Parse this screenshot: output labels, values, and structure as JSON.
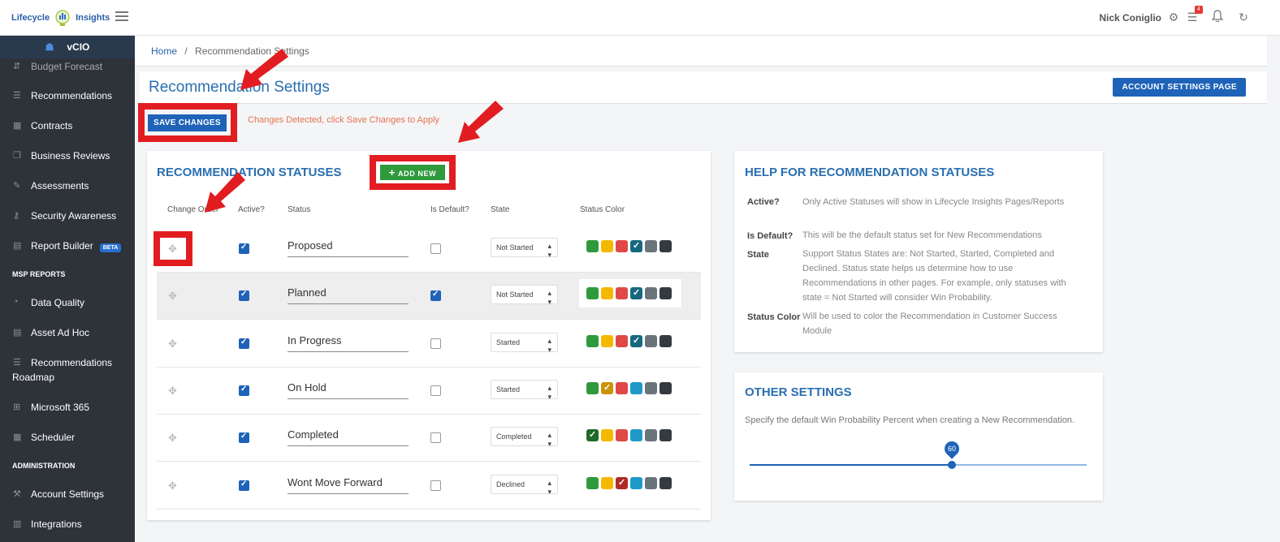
{
  "header": {
    "logo_left": "Lifecycle",
    "logo_right": "Insights",
    "user_name": "Nick Coniglio",
    "notification_count": "4"
  },
  "sidebar": {
    "module": "vCIO",
    "cutoff_item": "Budget Forecast",
    "items": [
      {
        "label": "Recommendations",
        "icon": "list-icon"
      },
      {
        "label": "Contracts",
        "icon": "contract-icon"
      },
      {
        "label": "Business Reviews",
        "icon": "copy-icon"
      },
      {
        "label": "Assessments",
        "icon": "edit-icon"
      },
      {
        "label": "Security Awareness",
        "icon": "key-icon"
      },
      {
        "label": "Report Builder",
        "icon": "file-icon",
        "badge": "BETA"
      }
    ],
    "section_msp": "MSP REPORTS",
    "msp_items": [
      {
        "label": "Data Quality",
        "icon": "gauge-icon"
      },
      {
        "label": "Asset Ad Hoc",
        "icon": "file-icon"
      },
      {
        "label": "Recommendations",
        "label2": "Roadmap",
        "icon": "list-icon"
      },
      {
        "label": "Microsoft 365",
        "icon": "windows-icon"
      },
      {
        "label": "Scheduler",
        "icon": "calendar-icon"
      }
    ],
    "section_admin": "ADMINISTRATION",
    "admin_items": [
      {
        "label": "Account Settings",
        "icon": "wrench-icon"
      },
      {
        "label": "Integrations",
        "icon": "grid-icon"
      }
    ]
  },
  "breadcrumb": {
    "home": "Home",
    "sep": "/",
    "current": "Recommendation Settings"
  },
  "page": {
    "title": "Recommendation Settings",
    "account_button": "ACCOUNT SETTINGS PAGE",
    "save_button": "SAVE CHANGES",
    "changes_msg": "Changes Detected, click Save Changes to Apply"
  },
  "statuses": {
    "title": "RECOMMENDATION STATUSES",
    "add_button": "ADD NEW",
    "columns": [
      "Change Order",
      "Active?",
      "Status",
      "Is Default?",
      "State",
      "Status Color"
    ],
    "colors": [
      "#2e9a3c",
      "#f5b800",
      "#e04848",
      "#1f9ac8",
      "#6b737b",
      "#343a40"
    ],
    "rows": [
      {
        "name": "Proposed",
        "active": true,
        "default": false,
        "state": "Not Started",
        "color_index": 3
      },
      {
        "name": "Planned",
        "active": true,
        "default": true,
        "state": "Not Started",
        "color_index": 3
      },
      {
        "name": "In Progress",
        "active": true,
        "default": false,
        "state": "Started",
        "color_index": 3
      },
      {
        "name": "On Hold",
        "active": true,
        "default": false,
        "state": "Started",
        "color_index": 1
      },
      {
        "name": "Completed",
        "active": true,
        "default": false,
        "state": "Completed",
        "color_index": 0
      },
      {
        "name": "Wont Move Forward",
        "active": true,
        "default": false,
        "state": "Declined",
        "color_index": 2
      }
    ]
  },
  "help": {
    "title": "HELP FOR RECOMMENDATION STATUSES",
    "active_label": "Active?",
    "active_text": "Only Active Statuses will show in Lifecycle Insights Pages/Reports",
    "default_label": "Is Default?",
    "default_text": "This will be the default status set for New Recommendations",
    "state_label": "State",
    "state_text": "Support Status States are: Not Started, Started, Completed and Declined. Status state helps us determine how to use Recommendations in other pages. For example, only statuses with state = Not Started will consider Win Probability.",
    "color_label": "Status Color",
    "color_text": "Will be used to color the Recommendation in Customer Success Module"
  },
  "other": {
    "title": "OTHER SETTINGS",
    "description": "Specify the default Win Probability Percent when creating a New Recommendation.",
    "win_probability": 60
  }
}
